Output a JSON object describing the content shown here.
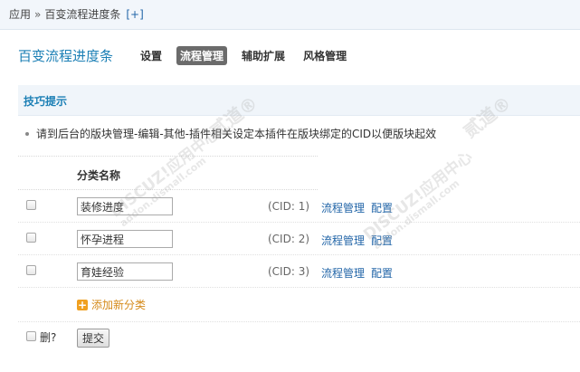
{
  "breadcrumb": {
    "root": "应用",
    "separator": "»",
    "current": "百变流程进度条",
    "add_link": "[+]"
  },
  "header": {
    "title": "百变流程进度条",
    "tabs": [
      {
        "label": "设置",
        "active": false
      },
      {
        "label": "流程管理",
        "active": true
      },
      {
        "label": "辅助扩展",
        "active": false
      },
      {
        "label": "风格管理",
        "active": false
      }
    ]
  },
  "tips": {
    "label": "技巧提示",
    "text": "请到后台的版块管理-编辑-其他-插件相关设定本插件在版块绑定的CID以便版块起效"
  },
  "table": {
    "column_header": "分类名称",
    "rows": [
      {
        "name": "装修进度",
        "cid": "(CID: 1)",
        "link1": "流程管理",
        "link2": "配置"
      },
      {
        "name": "怀孕进程",
        "cid": "(CID: 2)",
        "link1": "流程管理",
        "link2": "配置"
      },
      {
        "name": "育娃经验",
        "cid": "(CID: 3)",
        "link1": "流程管理",
        "link2": "配置"
      }
    ],
    "add_label": "添加新分类"
  },
  "footer": {
    "delete_label": "删?",
    "submit_label": "提交"
  },
  "watermark": {
    "text": "DISCUZ!应用中心",
    "domain": "addon.dismall.com",
    "mark": "贰道®"
  },
  "colors": {
    "accent": "#1b7fb5",
    "link": "#2366a8",
    "add": "#d58a1a",
    "active_tab_bg": "#6b6b6b"
  }
}
